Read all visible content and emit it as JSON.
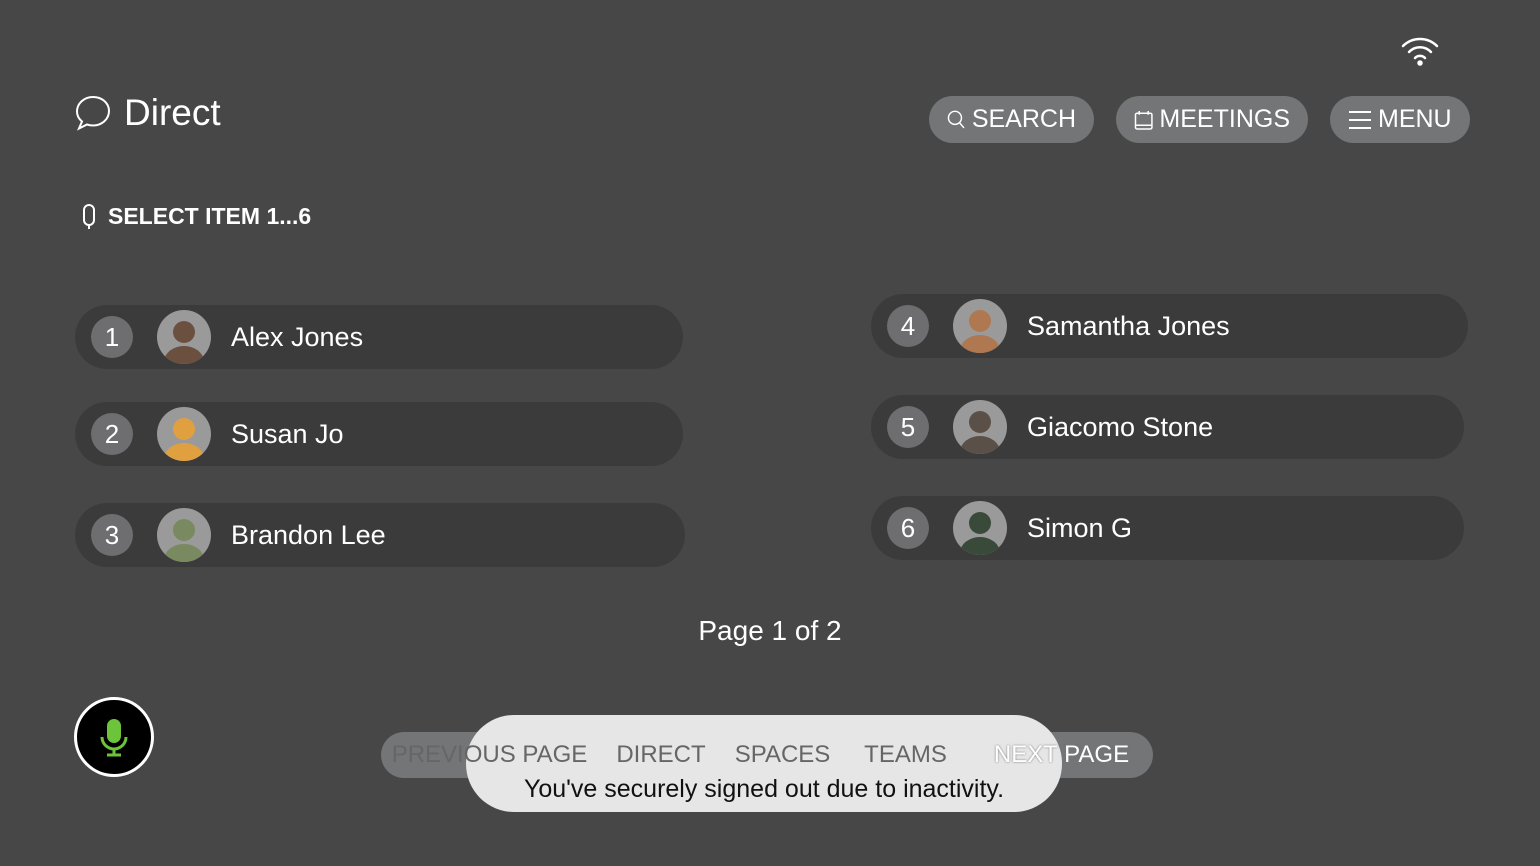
{
  "header": {
    "title": "Direct",
    "search_label": "SEARCH",
    "meetings_label": "MEETINGS",
    "menu_label": "MENU"
  },
  "hint": "SELECT ITEM 1...6",
  "contacts": [
    {
      "num": "1",
      "name": "Alex Jones",
      "color": "#6b5040"
    },
    {
      "num": "2",
      "name": "Susan Jo",
      "color": "#e0a040"
    },
    {
      "num": "3",
      "name": "Brandon Lee",
      "color": "#7a8a60"
    },
    {
      "num": "4",
      "name": "Samantha Jones",
      "color": "#b07850"
    },
    {
      "num": "5",
      "name": "Giacomo Stone",
      "color": "#5a5048"
    },
    {
      "num": "6",
      "name": "Simon G",
      "color": "#3a4a3a"
    }
  ],
  "pagination": "Page 1 of 2",
  "bottom_bar": [
    "PREVIOUS PAGE",
    "DIRECT",
    "SPACES",
    "TEAMS",
    "NEXT PAGE"
  ],
  "toast": "You've securely signed out due to inactivity.",
  "colors": {
    "mic": "#6cc43a",
    "background": "#474747"
  }
}
